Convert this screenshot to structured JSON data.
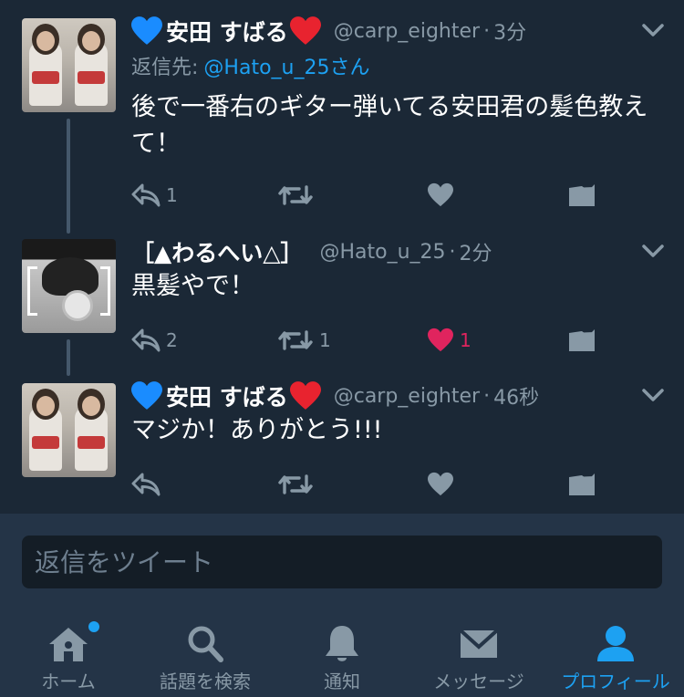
{
  "tweets": [
    {
      "display_name": "安田 すばる",
      "handle": "@carp_eighter",
      "time": "3分",
      "reply_to_label": "返信先:",
      "reply_to_user": "@Hato_u_25さん",
      "text": "後で一番右のギター弾いてる安田君の髪色教えて！",
      "reply_count": "1",
      "retweet_count": "",
      "like_count": "",
      "liked": false
    },
    {
      "display_name": "［▲わるへい△］",
      "handle": "@Hato_u_25",
      "time": "2分",
      "text": "黒髪やで！",
      "reply_count": "2",
      "retweet_count": "1",
      "like_count": "1",
      "liked": true
    },
    {
      "display_name": "安田 すばる",
      "handle": "@carp_eighter",
      "time": "46秒",
      "text": "マジか！ありがとう!!!",
      "reply_count": "",
      "retweet_count": "",
      "like_count": "",
      "liked": false
    }
  ],
  "separator": "·",
  "composer": {
    "placeholder": "返信をツイート"
  },
  "tabbar": {
    "items": [
      {
        "label": "ホーム",
        "icon": "home-icon",
        "active": false,
        "badge": true
      },
      {
        "label": "話題を検索",
        "icon": "search-icon",
        "active": false
      },
      {
        "label": "通知",
        "icon": "bell-icon",
        "active": false
      },
      {
        "label": "メッセージ",
        "icon": "envelope-icon",
        "active": false
      },
      {
        "label": "プロフィール",
        "icon": "profile-icon",
        "active": true
      }
    ]
  },
  "colors": {
    "background": "#1b2836",
    "bar": "#243447",
    "accent": "#1da1f2",
    "muted": "#8899a6",
    "like": "#e0245e",
    "blue_heart": "#1a8cff",
    "red_heart": "#e8232f"
  }
}
